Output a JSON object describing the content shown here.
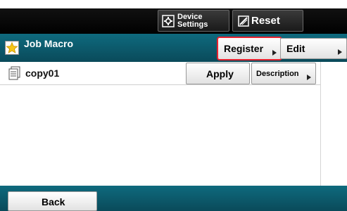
{
  "top": {
    "device_settings_line1": "Device",
    "device_settings_line2": "Settings",
    "reset_label": "Reset"
  },
  "header": {
    "title": "Job Macro",
    "register_label": "Register",
    "edit_label": "Edit"
  },
  "macros": [
    {
      "name": "copy01",
      "apply_label": "Apply",
      "description_label": "Description"
    }
  ],
  "footer": {
    "back_label": "Back"
  },
  "colors": {
    "teal_bar": "#0e6a7e",
    "highlight_red": "#e8222f"
  }
}
